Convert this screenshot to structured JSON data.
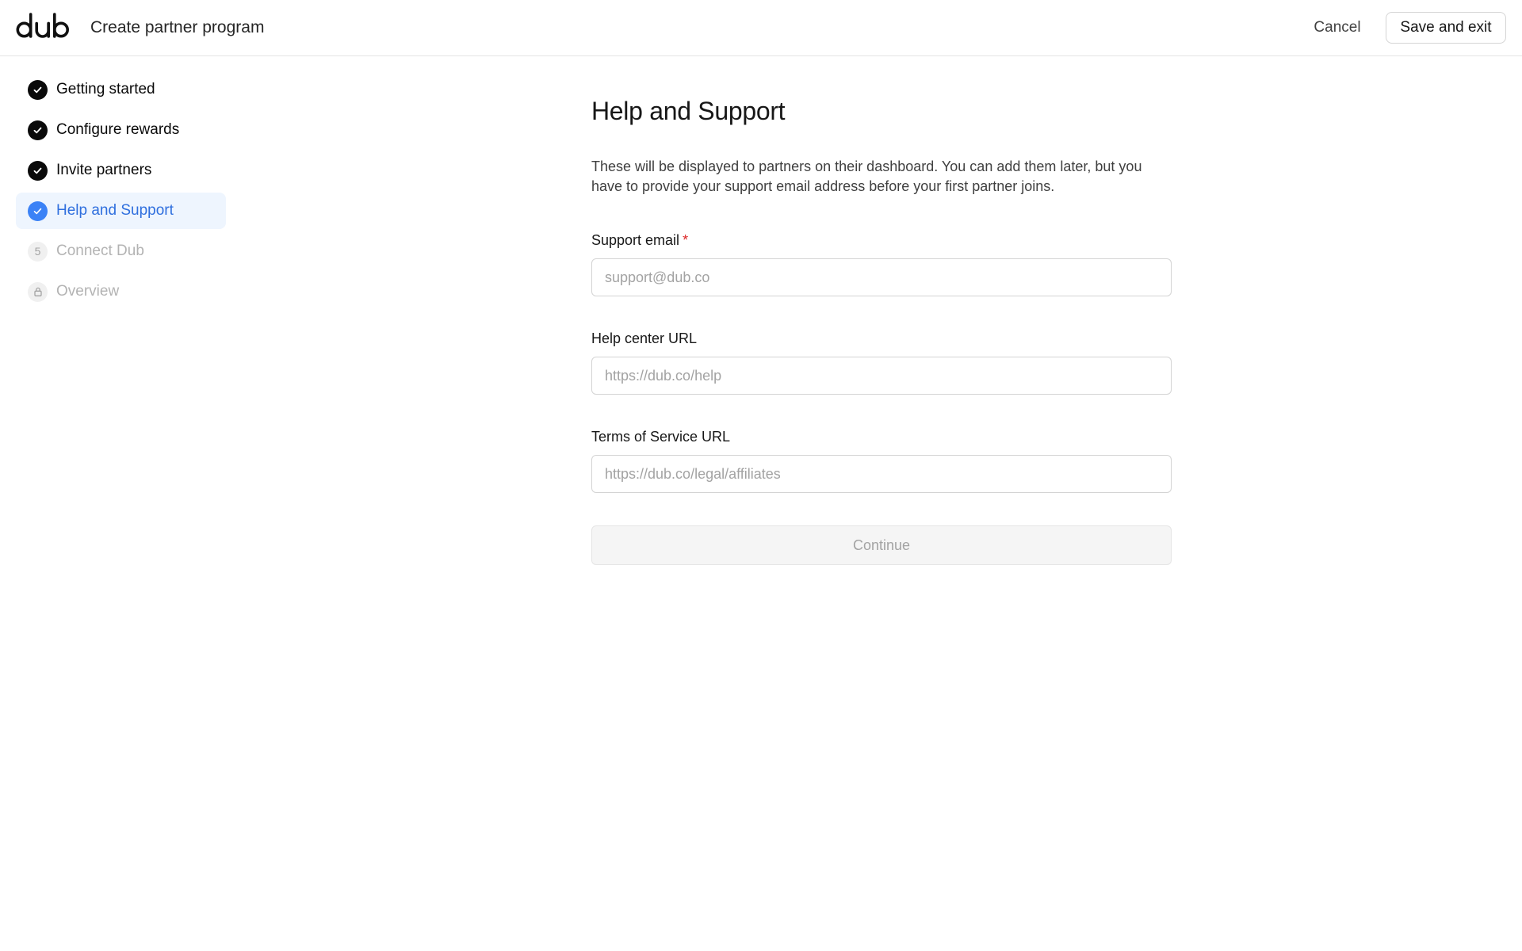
{
  "app": {
    "logo_text": "dub",
    "title": "Create partner program"
  },
  "header": {
    "cancel_label": "Cancel",
    "save_label": "Save and exit"
  },
  "steps": [
    {
      "label": "Getting started",
      "state": "done"
    },
    {
      "label": "Configure rewards",
      "state": "done"
    },
    {
      "label": "Invite partners",
      "state": "done"
    },
    {
      "label": "Help and Support",
      "state": "current"
    },
    {
      "label": "Connect Dub",
      "state": "pending",
      "number": "5"
    },
    {
      "label": "Overview",
      "state": "locked"
    }
  ],
  "main": {
    "title": "Help and Support",
    "description": "These will be displayed to partners on their dashboard. You can add them later, but you have to provide your support email address before your first partner joins.",
    "fields": {
      "support_email": {
        "label": "Support email",
        "required_marker": "*",
        "placeholder": "support@dub.co",
        "value": ""
      },
      "help_center": {
        "label": "Help center URL",
        "placeholder": "https://dub.co/help",
        "value": ""
      },
      "terms": {
        "label": "Terms of Service URL",
        "placeholder": "https://dub.co/legal/affiliates",
        "value": ""
      }
    },
    "continue_label": "Continue"
  },
  "colors": {
    "accent": "#3b82f6",
    "accent_text": "#2f6fde",
    "active_bg": "#eef5fe",
    "required": "#dc2626",
    "border": "#e5e5e5"
  },
  "icons": {
    "done": "check-circle-icon",
    "current": "check-circle-icon",
    "locked": "lock-icon"
  }
}
